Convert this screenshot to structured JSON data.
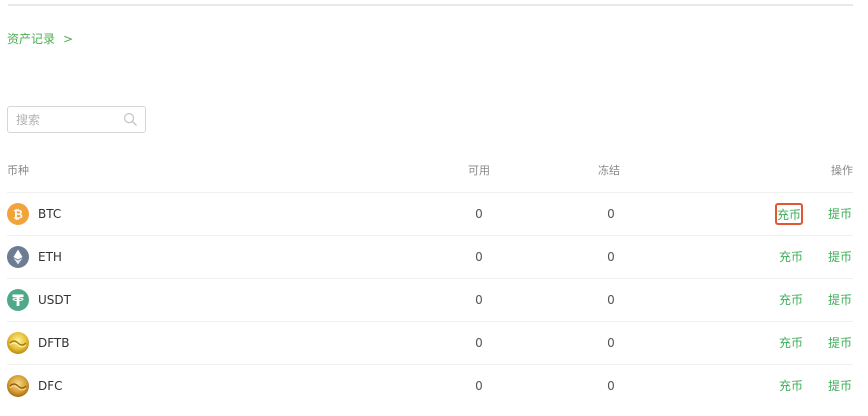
{
  "breadcrumb": {
    "label": "资产记录",
    "chevron": ">"
  },
  "search": {
    "placeholder": "搜索",
    "value": ""
  },
  "table": {
    "headers": {
      "currency": "币种",
      "available": "可用",
      "frozen": "冻结",
      "actions": "操作"
    },
    "rows": [
      {
        "symbol": "BTC",
        "available": "0",
        "frozen": "0",
        "deposit": "充币",
        "withdraw": "提币",
        "icon": "btc-icon"
      },
      {
        "symbol": "ETH",
        "available": "0",
        "frozen": "0",
        "deposit": "充币",
        "withdraw": "提币",
        "icon": "eth-icon"
      },
      {
        "symbol": "USDT",
        "available": "0",
        "frozen": "0",
        "deposit": "充币",
        "withdraw": "提币",
        "icon": "usdt-icon"
      },
      {
        "symbol": "DFTB",
        "available": "0",
        "frozen": "0",
        "deposit": "充币",
        "withdraw": "提币",
        "icon": "dftb-icon"
      },
      {
        "symbol": "DFC",
        "available": "0",
        "frozen": "0",
        "deposit": "充币",
        "withdraw": "提币",
        "icon": "dfc-icon"
      }
    ]
  },
  "colors": {
    "accent": "#3fae5a",
    "highlight_border": "#e2572f",
    "btc": "#f2a33a",
    "eth": "#627eea",
    "usdt": "#26a17b",
    "dftb": "#e8c23a",
    "dfc": "#d9a23a"
  }
}
